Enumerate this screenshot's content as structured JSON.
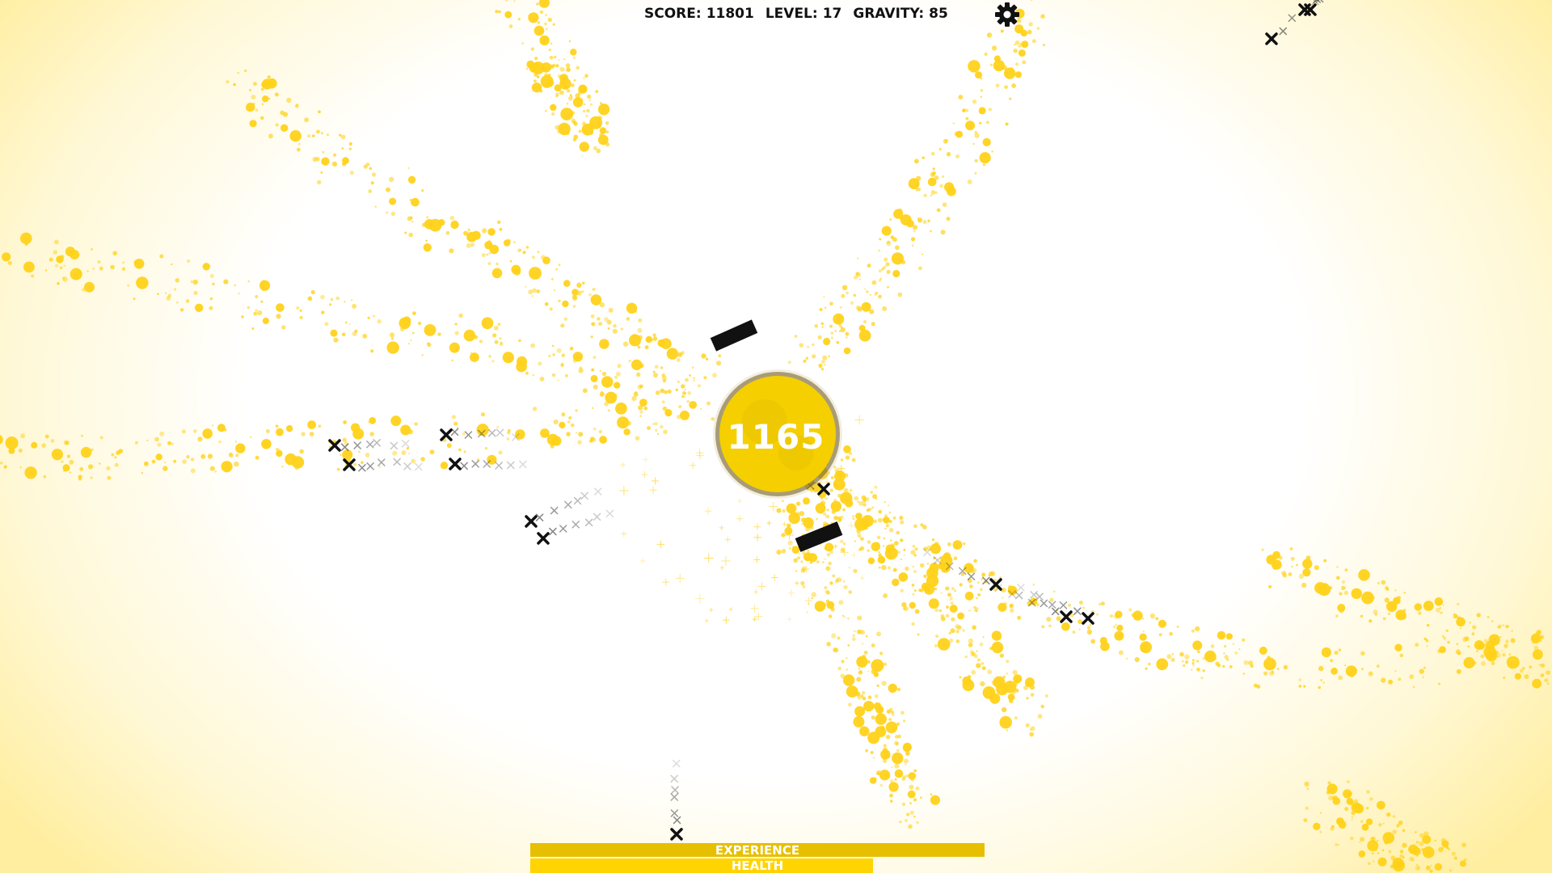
{
  "hud": {
    "score_label": "SCORE:",
    "score_value": "11801",
    "level_label": "LEVEL:",
    "level_value": "17",
    "gravity_label": "GRAVITY:",
    "gravity_value": "85"
  },
  "settings": {
    "icon": "gear-icon"
  },
  "core": {
    "value": "1165",
    "color": "#f5cf00"
  },
  "bars": {
    "experience_label": "EXPERIENCE",
    "experience_fraction": 1.0,
    "health_label": "HEALTH",
    "health_fraction": 0.755
  },
  "colors": {
    "accent": "#f5cf00",
    "particle": "#ffd21a",
    "enemy": "#111111",
    "xp_bar": "#e6c000",
    "hp_bar": "#ffd400"
  }
}
